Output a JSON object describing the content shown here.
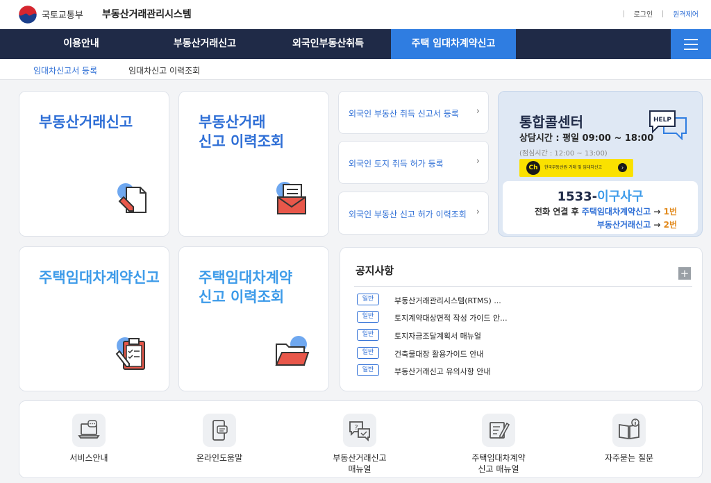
{
  "header": {
    "ministry": "국토교통부",
    "system_title": "부동산거래관리시스템",
    "login": "로그인",
    "remote_control": "원격제어"
  },
  "nav": {
    "items": [
      "이용안내",
      "부동산거래신고",
      "외국인부동산취득",
      "주택 임대차계약신고"
    ],
    "active_index": 3
  },
  "subnav": {
    "items": [
      "임대차신고서 등록",
      "임대차신고 이력조회"
    ]
  },
  "cards": {
    "realestate_report": "부동산거래신고",
    "realestate_history_line1": "부동산거래",
    "realestate_history_line2": "신고 이력조회",
    "housing_lease_report": "주택임대차계약신고",
    "housing_lease_history_line1": "주택임대차계약",
    "housing_lease_history_line2": "신고 이력조회"
  },
  "foreign_links": [
    "외국인 부동산 취득 신고서 등록",
    "외국인 토지 취득 허가 등록",
    "외국인 부동산 신고 허가 이력조회"
  ],
  "call_center": {
    "title": "통합콜센터",
    "hours": "상담시간 : 평일 09:00 ~ 18:00",
    "lunch": "(점심시간 : 12:00 ~ 13:00)",
    "help_bubble": "HELP",
    "kakao_ch": "Ch",
    "kakao_text": "한국부동산원 거래 및 임대차신고",
    "phone_prefix": "1533-",
    "phone_word": "이구사구",
    "route1_prefix": "전화 연결 후",
    "route1_service": "주택임대차계약신고",
    "route1_arrow": "→",
    "route1_num": "1번",
    "route2_service": "부동산거래신고",
    "route2_arrow": "→",
    "route2_num": "2번"
  },
  "notice": {
    "title": "공지사항",
    "more": "+",
    "items": [
      {
        "badge": "일반",
        "text": "부동산거래관리시스템(RTMS) ..."
      },
      {
        "badge": "일반",
        "text": "토지계약대상면적 작성 가이드 안..."
      },
      {
        "badge": "일반",
        "text": "토지자금조달계획서 매뉴얼"
      },
      {
        "badge": "일반",
        "text": "건축물대장 활용가이드 안내"
      },
      {
        "badge": "일반",
        "text": "부동산거래신고 유의사항 안내"
      }
    ]
  },
  "quick_links": [
    {
      "label": "서비스안내",
      "icon": "laptop-chat-icon"
    },
    {
      "label": "온라인도움말",
      "icon": "phone-chat-icon"
    },
    {
      "label": "부동산거래신고\n매뉴얼",
      "icon": "speech-bubbles-icon"
    },
    {
      "label": "주택임대차계약\n신고 매뉴얼",
      "icon": "note-pen-icon"
    },
    {
      "label": "자주묻는 질문",
      "icon": "book-info-icon"
    }
  ],
  "colors": {
    "navy": "#1f2a47",
    "accent": "#2f7de1",
    "link_blue": "#2f6fd6",
    "light_blue": "#3d9be9",
    "orange": "#e2891b",
    "kakao_yellow": "#fae100"
  }
}
